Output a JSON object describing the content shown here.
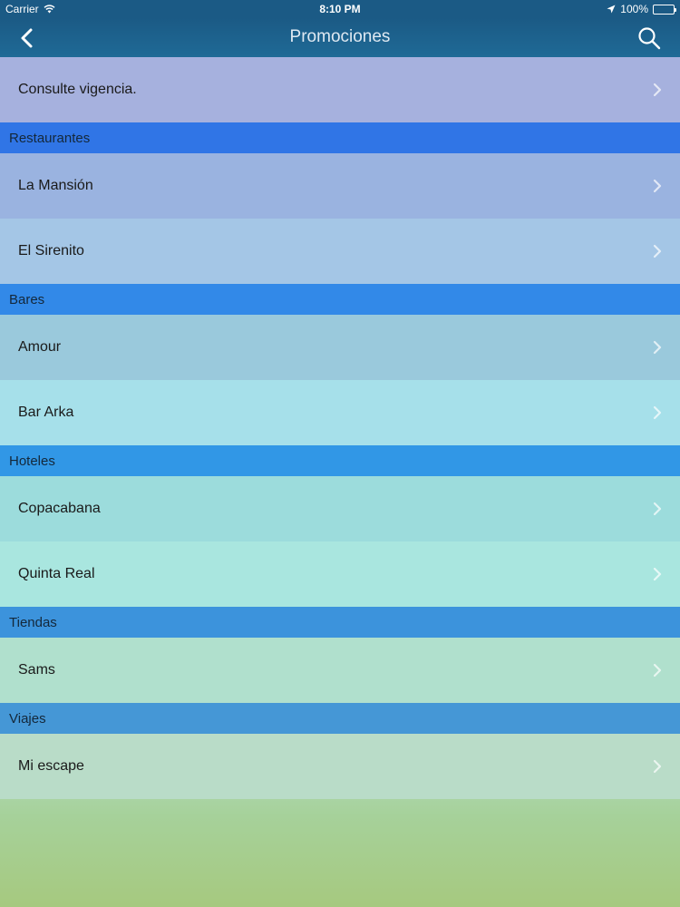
{
  "status_bar": {
    "carrier": "Carrier",
    "time": "8:10 PM",
    "battery": "100%"
  },
  "nav": {
    "title": "Promociones"
  },
  "notice": {
    "label": "Consulte vigencia."
  },
  "sections": [
    {
      "title": "Restaurantes",
      "items": [
        "La Mansión",
        "El Sirenito"
      ]
    },
    {
      "title": "Bares",
      "items": [
        "Amour",
        "Bar Arka"
      ]
    },
    {
      "title": "Hoteles",
      "items": [
        "Copacabana",
        "Quinta Real"
      ]
    },
    {
      "title": "Tiendas",
      "items": [
        "Sams"
      ]
    },
    {
      "title": "Viajes",
      "items": [
        "Mi escape"
      ]
    }
  ],
  "colors": {
    "nav_bar": "#1b5a85",
    "section_headers": [
      "#3075e6",
      "#3289e8",
      "#3197e6",
      "#3c93dc",
      "#4597d6"
    ],
    "row_tints": [
      [
        "#9ab3e0",
        "#a4c6e6"
      ],
      [
        "#9ac9dc",
        "#a6e0ea"
      ],
      [
        "#9cdcdc",
        "#a9e6df"
      ],
      [
        "#b0e0cd"
      ],
      [
        "#b9dcc8"
      ]
    ],
    "notice_row": "#a6b1de"
  },
  "icons": {
    "back": "chevron-left-icon",
    "search": "search-icon",
    "row_disclosure": "chevron-right-icon",
    "wifi": "wifi-icon",
    "location": "location-arrow-icon",
    "battery": "battery-icon"
  }
}
